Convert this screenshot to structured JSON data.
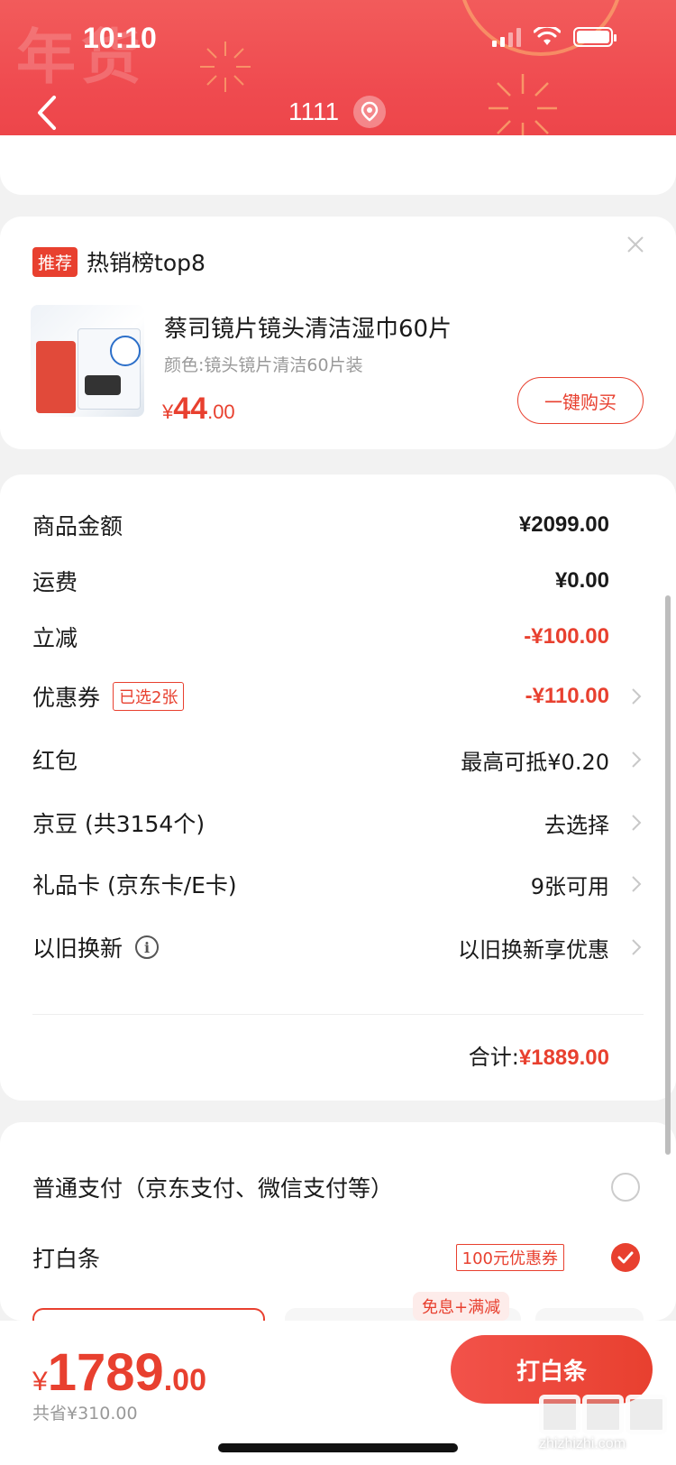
{
  "status_bar": {
    "time": "10:10"
  },
  "header": {
    "deco_text": "年货",
    "address": "1111"
  },
  "recommend": {
    "tag": "推荐",
    "title": "热销榜top8",
    "product_name": "蔡司镜片镜头清洁湿巾60片",
    "product_spec": "颜色:镜头镜片清洁60片装",
    "price_currency": "¥",
    "price_int": "44",
    "price_dec": ".00",
    "buy_label": "一键购买"
  },
  "summary": {
    "rows": [
      {
        "label": "商品金额",
        "value": "¥2099.00"
      },
      {
        "label": "运费",
        "value": "¥0.00"
      },
      {
        "label": "立减",
        "value": "-¥100.00"
      },
      {
        "label": "优惠券",
        "tag": "已选2张",
        "value": "-¥110.00"
      },
      {
        "label": "红包",
        "value": "最高可抵¥0.20"
      },
      {
        "label": "京豆 (共3154个)",
        "value": "去选择"
      },
      {
        "label": "礼品卡 (京东卡/E卡)",
        "value": "9张可用"
      },
      {
        "label": "以旧换新",
        "info": "i",
        "value": "以旧换新享优惠"
      }
    ],
    "total_label": "合计:",
    "total_value": "¥1889.00"
  },
  "payment": {
    "normal_label": "普通支付（京东支付、微信支付等）",
    "baitiao_label": "打白条",
    "coupon_chip": "100元优惠券",
    "plan_badge": "免息+满减"
  },
  "bottom": {
    "currency": "¥",
    "price_int": "1789",
    "price_dec": ".00",
    "saved": "共省¥310.00",
    "pay_button": "打白条"
  },
  "watermark": {
    "text": "zhizhizhi.com"
  },
  "colors": {
    "accent": "#e8402f",
    "header": "#ef4a4f"
  }
}
